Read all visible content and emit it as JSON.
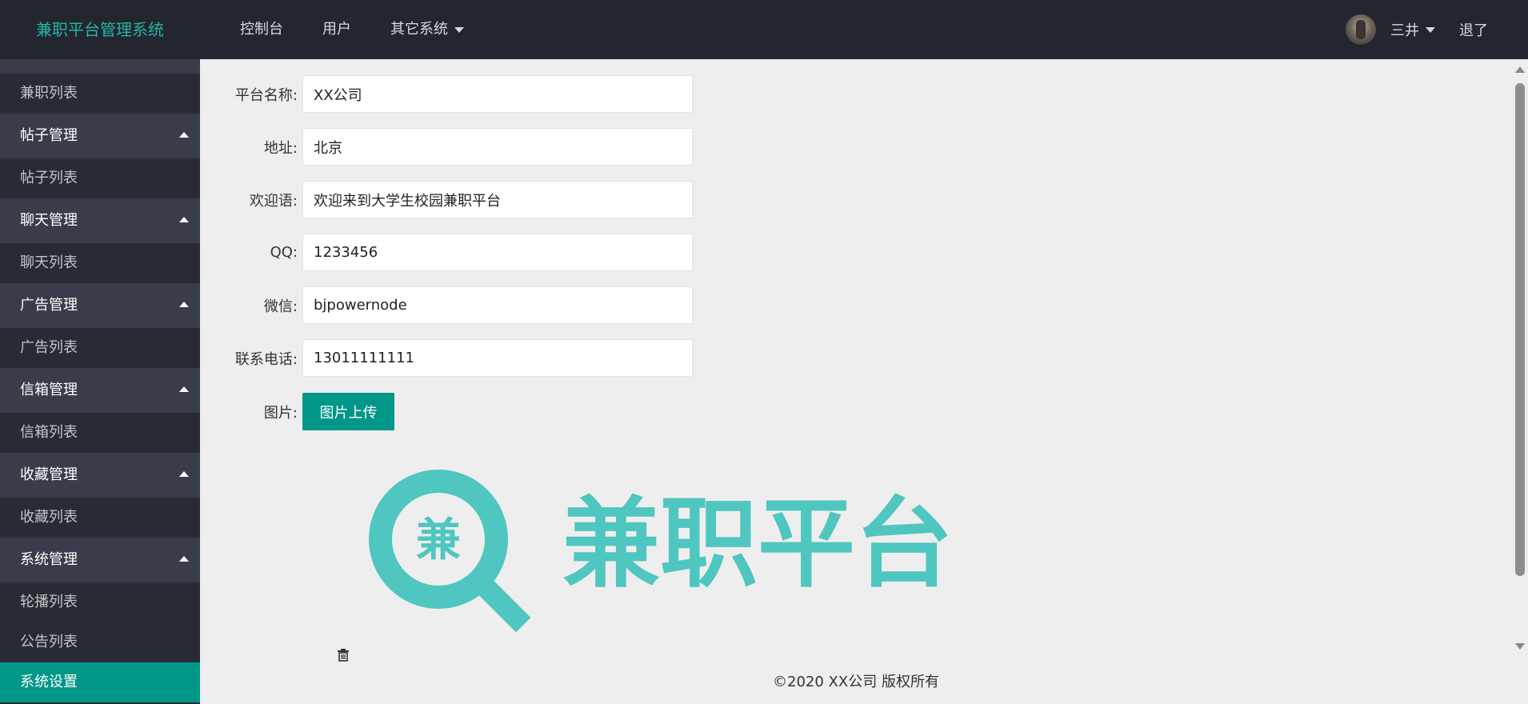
{
  "header": {
    "brand": "兼职平台管理系统",
    "nav": [
      {
        "label": "控制台"
      },
      {
        "label": "用户"
      },
      {
        "label": "其它系统"
      }
    ],
    "user": {
      "name": "三井"
    },
    "logout": "退了"
  },
  "sidebar": {
    "items": [
      {
        "type": "item",
        "label": "兼职列表"
      },
      {
        "type": "group",
        "label": "帖子管理"
      },
      {
        "type": "item",
        "label": "帖子列表"
      },
      {
        "type": "group",
        "label": "聊天管理"
      },
      {
        "type": "item",
        "label": "聊天列表"
      },
      {
        "type": "group",
        "label": "广告管理"
      },
      {
        "type": "item",
        "label": "广告列表"
      },
      {
        "type": "group",
        "label": "信箱管理"
      },
      {
        "type": "item",
        "label": "信箱列表"
      },
      {
        "type": "group",
        "label": "收藏管理"
      },
      {
        "type": "item",
        "label": "收藏列表"
      },
      {
        "type": "group",
        "label": "系统管理"
      },
      {
        "type": "item",
        "label": "轮播列表"
      },
      {
        "type": "item",
        "label": "公告列表"
      },
      {
        "type": "item",
        "label": "系统设置",
        "active": true
      }
    ]
  },
  "form": {
    "fields": [
      {
        "label": "平台名称:",
        "value": "XX公司"
      },
      {
        "label": "地址:",
        "value": "北京"
      },
      {
        "label": "欢迎语:",
        "value": "欢迎来到大学生校园兼职平台"
      },
      {
        "label": "QQ:",
        "value": "1233456"
      },
      {
        "label": "微信:",
        "value": "bjpowernode"
      },
      {
        "label": "联系电话:",
        "value": "13011111111"
      }
    ],
    "image_label": "图片:",
    "upload_button": "图片上传"
  },
  "logo": {
    "badge_char": "兼",
    "text": "兼职平台",
    "color": "#4fc6c0"
  },
  "footer": {
    "copyright": "©2020 XX公司 版权所有"
  },
  "colors": {
    "header_bg": "#23262e",
    "sidebar_bg": "#282b33",
    "sidebar_group_bg": "#393d49",
    "accent": "#009688",
    "brand": "#22b5a7"
  }
}
